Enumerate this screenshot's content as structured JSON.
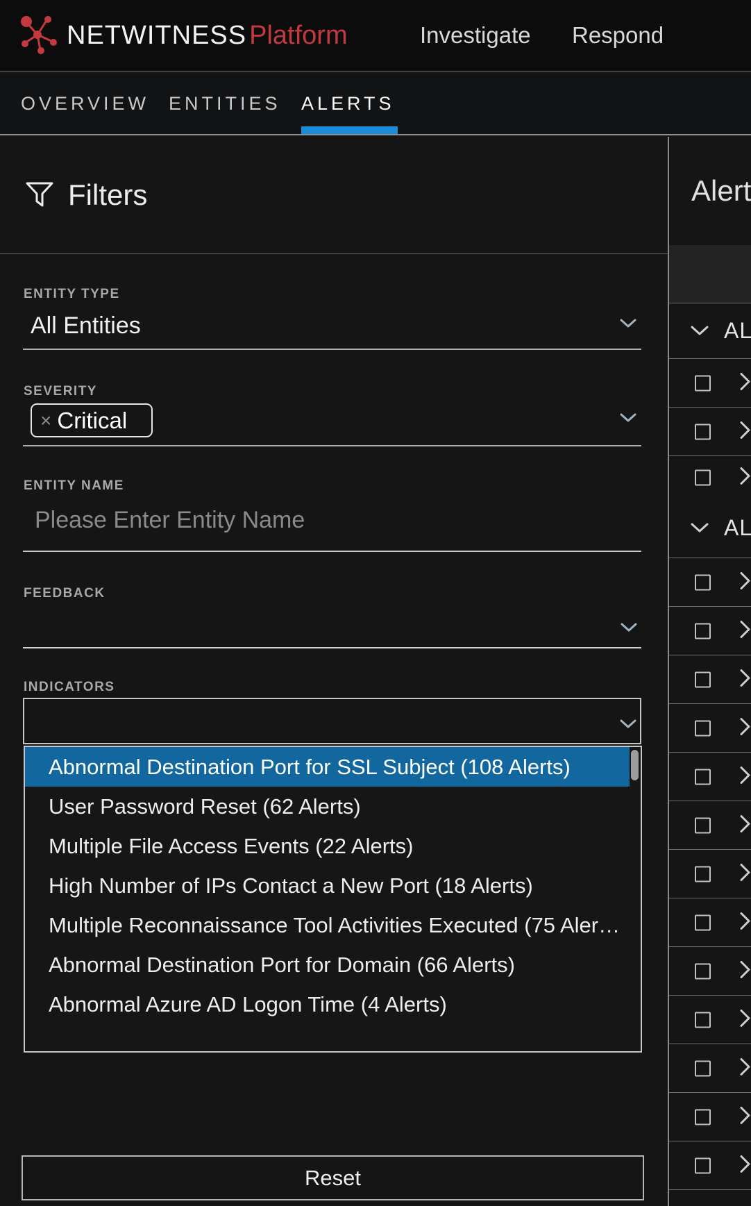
{
  "colors": {
    "accent_blue_tab": "#1a8cd8",
    "selected_option_blue": "#12689e",
    "brand_red": "#c23a3f",
    "page_background": "#151515"
  },
  "header": {
    "brand_name": "NETWITNESS",
    "brand_suffix": "Platform",
    "nav": {
      "investigate": "Investigate",
      "respond": "Respond"
    }
  },
  "tabs": {
    "overview": "OVERVIEW",
    "entities": "ENTITIES",
    "alerts": "ALERTS",
    "active_tab": "ALERTS"
  },
  "filters": {
    "title": "Filters",
    "entity_type": {
      "label": "ENTITY TYPE",
      "value": "All Entities"
    },
    "severity": {
      "label": "SEVERITY",
      "chip": {
        "remove_glyph": "×",
        "text": "Critical"
      }
    },
    "entity_name": {
      "label": "ENTITY NAME",
      "value": "",
      "placeholder": "Please Enter Entity Name"
    },
    "feedback": {
      "label": "FEEDBACK",
      "value": ""
    },
    "indicators": {
      "label": "INDICATORS",
      "value": "",
      "options": [
        {
          "text": "Abnormal Destination Port for SSL Subject (108 Alerts)",
          "selected": true
        },
        {
          "text": "User Password Reset (62 Alerts)",
          "selected": false
        },
        {
          "text": "Multiple File Access Events (22 Alerts)",
          "selected": false
        },
        {
          "text": "High Number of IPs Contact a New Port (18 Alerts)",
          "selected": false
        },
        {
          "text": "Multiple Reconnaissance Tool Activities Executed (75 Aler…",
          "selected": false
        },
        {
          "text": "Abnormal Destination Port for Domain (66 Alerts)",
          "selected": false
        },
        {
          "text": "Abnormal Azure AD Logon Time (4 Alerts)",
          "selected": false
        }
      ]
    },
    "reset_label": "Reset"
  },
  "alerts_panel": {
    "title": "Alert",
    "rows": [
      {
        "type": "group",
        "label": "ALL"
      },
      {
        "type": "item"
      },
      {
        "type": "item"
      },
      {
        "type": "item"
      },
      {
        "type": "group",
        "label": "ALL"
      },
      {
        "type": "item"
      },
      {
        "type": "item"
      },
      {
        "type": "item"
      },
      {
        "type": "item"
      },
      {
        "type": "item"
      },
      {
        "type": "item"
      },
      {
        "type": "item"
      },
      {
        "type": "item"
      },
      {
        "type": "item"
      },
      {
        "type": "item"
      },
      {
        "type": "item"
      },
      {
        "type": "item"
      },
      {
        "type": "item"
      }
    ]
  }
}
